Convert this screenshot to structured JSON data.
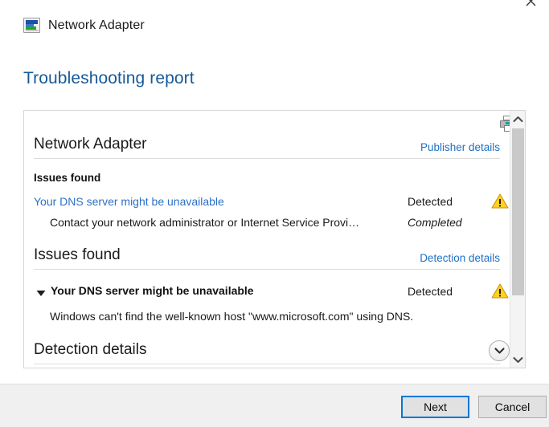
{
  "window": {
    "title": "Network Adapter",
    "adapter_icon": "network-adapter-icon",
    "close_icon": "close-icon"
  },
  "page": {
    "heading": "Troubleshooting report"
  },
  "report": {
    "print_icon": "printer-icon",
    "sections": [
      {
        "title": "Network Adapter",
        "link": "Publisher details",
        "subheading": "Issues found",
        "rows": [
          {
            "label": "Your DNS server might be unavailable",
            "status": "Detected",
            "icon": "warning-icon"
          },
          {
            "label": "Contact your network administrator or Internet Service Provi…",
            "status": "Completed",
            "icon": ""
          }
        ]
      },
      {
        "title": "Issues found",
        "link": "Detection details",
        "rows": [
          {
            "toggle": "triangle-down-icon",
            "label": "Your DNS server might be unavailable",
            "status": "Detected",
            "icon": "warning-icon"
          },
          {
            "label": "Windows can't find the well-known host \"www.microsoft.com\" using DNS.",
            "status": "",
            "icon": ""
          }
        ]
      },
      {
        "title": "Detection details",
        "link": "",
        "rows": []
      }
    ],
    "expand_button_icon": "chevron-down-circle-icon",
    "scrollbar": {
      "up_icon": "chevron-up-icon",
      "down_icon": "chevron-down-icon"
    }
  },
  "footer": {
    "next_label": "Next",
    "cancel_label": "Cancel"
  },
  "colors": {
    "accent_blue": "#0078d7",
    "heading_blue": "#16599a",
    "link_blue": "#1f6fc4",
    "warning_yellow": "#ffd021"
  }
}
